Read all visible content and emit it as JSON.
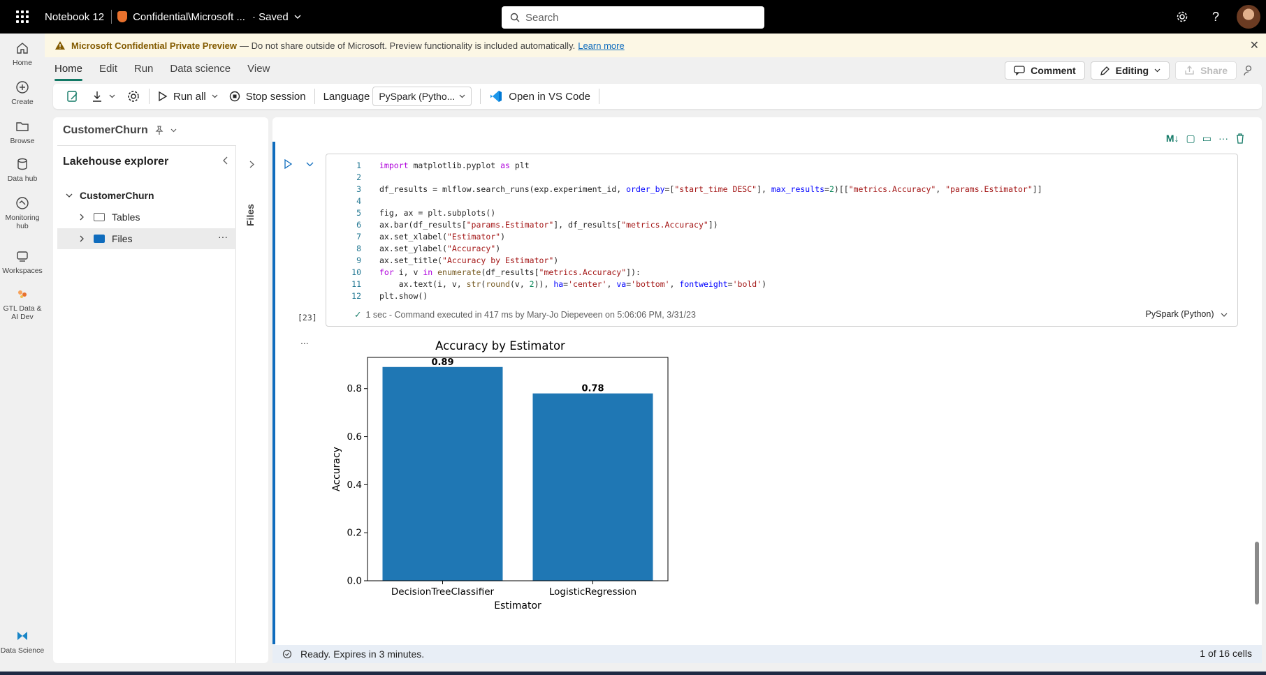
{
  "topbar": {
    "notebook_name": "Notebook 12",
    "sensitivity": "Confidential\\Microsoft ...",
    "save_state": "· Saved",
    "search_placeholder": "Search"
  },
  "leftnav": [
    {
      "label": "Home",
      "icon": "home-icon"
    },
    {
      "label": "Create",
      "icon": "plus-circle-icon"
    },
    {
      "label": "Browse",
      "icon": "folder-icon"
    },
    {
      "label": "Data hub",
      "icon": "database-icon"
    },
    {
      "label": "Monitoring hub",
      "icon": "monitor-icon"
    },
    {
      "label": "Workspaces",
      "icon": "workspaces-icon"
    },
    {
      "label": "GTL Data & AI Dev",
      "icon": "workspace-logo-icon"
    },
    {
      "label": "Data Science",
      "icon": "data-science-icon"
    }
  ],
  "banner": {
    "title": "Microsoft Confidential Private Preview",
    "message": "— Do not share outside of Microsoft. Preview functionality is included automatically.",
    "link": "Learn more"
  },
  "ribbon": {
    "tabs": [
      "Home",
      "Edit",
      "Run",
      "Data science",
      "View"
    ],
    "comment": "Comment",
    "editing": "Editing",
    "share": "Share"
  },
  "toolbar": {
    "run_all": "Run all",
    "stop_session": "Stop session",
    "language_label": "Language",
    "language_value": "PySpark (Pytho...",
    "open_vscode": "Open in VS Code"
  },
  "explorer": {
    "lakehouse": "CustomerChurn",
    "header": "Lakehouse explorer",
    "root": "CustomerChurn",
    "items": [
      "Tables",
      "Files"
    ],
    "vertical_tab": "Files"
  },
  "cell": {
    "exec_count": "[23]",
    "exec_status": "1 sec - Command executed in 417 ms by Mary-Jo Diepeveen on 5:06:06 PM, 3/31/23",
    "language": "PySpark (Python)",
    "output_menu": "...",
    "code_lines": [
      "import matplotlib.pyplot as plt",
      "",
      "df_results = mlflow.search_runs(exp.experiment_id, order_by=[\"start_time DESC\"], max_results=2)[[\"metrics.Accuracy\", \"params.Estimator\"]]",
      "",
      "fig, ax = plt.subplots()",
      "ax.bar(df_results[\"params.Estimator\"], df_results[\"metrics.Accuracy\"])",
      "ax.set_xlabel(\"Estimator\")",
      "ax.set_ylabel(\"Accuracy\")",
      "ax.set_title(\"Accuracy by Estimator\")",
      "for i, v in enumerate(df_results[\"metrics.Accuracy\"]):",
      "    ax.text(i, v, str(round(v, 2)), ha='center', va='bottom', fontweight='bold')",
      "plt.show()"
    ]
  },
  "status": {
    "ready": "Ready. Expires in 3 minutes.",
    "cells": "1 of 16 cells"
  },
  "chart_data": {
    "type": "bar",
    "title": "Accuracy by Estimator",
    "xlabel": "Estimator",
    "ylabel": "Accuracy",
    "categories": [
      "DecisionTreeClassifier",
      "LogisticRegression"
    ],
    "values": [
      0.89,
      0.78
    ],
    "data_labels": [
      "0.89",
      "0.78"
    ],
    "yticks": [
      "0.0",
      "0.2",
      "0.4",
      "0.6",
      "0.8"
    ],
    "ylim": [
      0,
      0.93
    ],
    "bar_color": "#1f77b4"
  }
}
